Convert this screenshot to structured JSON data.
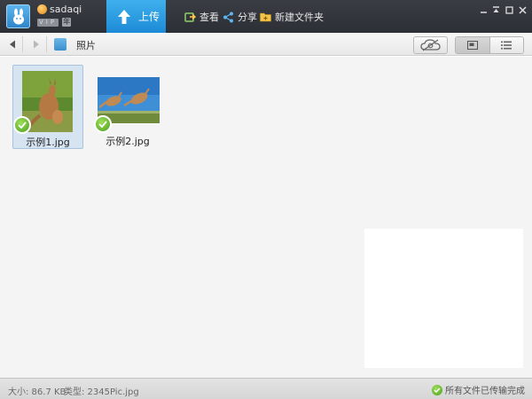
{
  "header": {
    "username": "sadaqi",
    "vip_badge": "VIP",
    "year_badge": "年",
    "upload_tab": "上传",
    "tools": {
      "view": "查看",
      "share": "分享",
      "new_folder": "新建文件夹"
    },
    "window_controls": [
      "minimize",
      "restore",
      "maximize",
      "close"
    ]
  },
  "navbar": {
    "breadcrumb": "照片"
  },
  "files": [
    {
      "name": "示例1.jpg",
      "selected": true,
      "uploaded": true
    },
    {
      "name": "示例2.jpg",
      "selected": false,
      "uploaded": true
    }
  ],
  "status": {
    "size": "大小: 86.7 KB",
    "type": "类型: 2345Pic.jpg",
    "transfer": "所有文件已传输完成"
  },
  "colors": {
    "titlebar": "#2f3238",
    "upload_tab": "#1f8fdb",
    "check_green": "#5cb82a",
    "selected_bg": "#d6e4f2"
  },
  "icons": {
    "logo": "rabbit-logo-icon",
    "upload": "up-arrow-icon",
    "view": "view-icon",
    "share": "share-icon",
    "folder": "new-folder-icon",
    "sync": "cloud-sync-icon",
    "thumbnail_view": "thumbnail-view-icon",
    "list_view": "list-view-icon"
  }
}
